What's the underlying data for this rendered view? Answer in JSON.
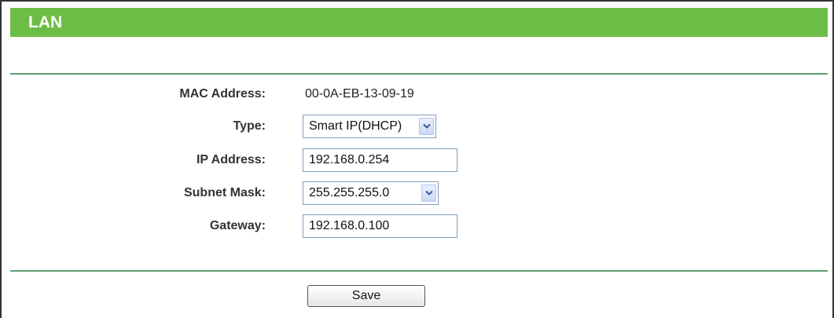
{
  "page": {
    "title": "LAN"
  },
  "form": {
    "mac_address": {
      "label": "MAC Address:",
      "value": "00-0A-EB-13-09-19"
    },
    "type": {
      "label": "Type:",
      "value": "Smart IP(DHCP)"
    },
    "ip_address": {
      "label": "IP Address:",
      "value": "192.168.0.254"
    },
    "subnet_mask": {
      "label": "Subnet Mask:",
      "value": "255.255.255.0"
    },
    "gateway": {
      "label": "Gateway:",
      "value": "192.168.0.100"
    }
  },
  "actions": {
    "save_label": "Save"
  },
  "icons": {
    "dropdown": "chevron-down-icon"
  },
  "colors": {
    "title_bar": "#6cbd45",
    "divider": "#5a9e6f"
  }
}
